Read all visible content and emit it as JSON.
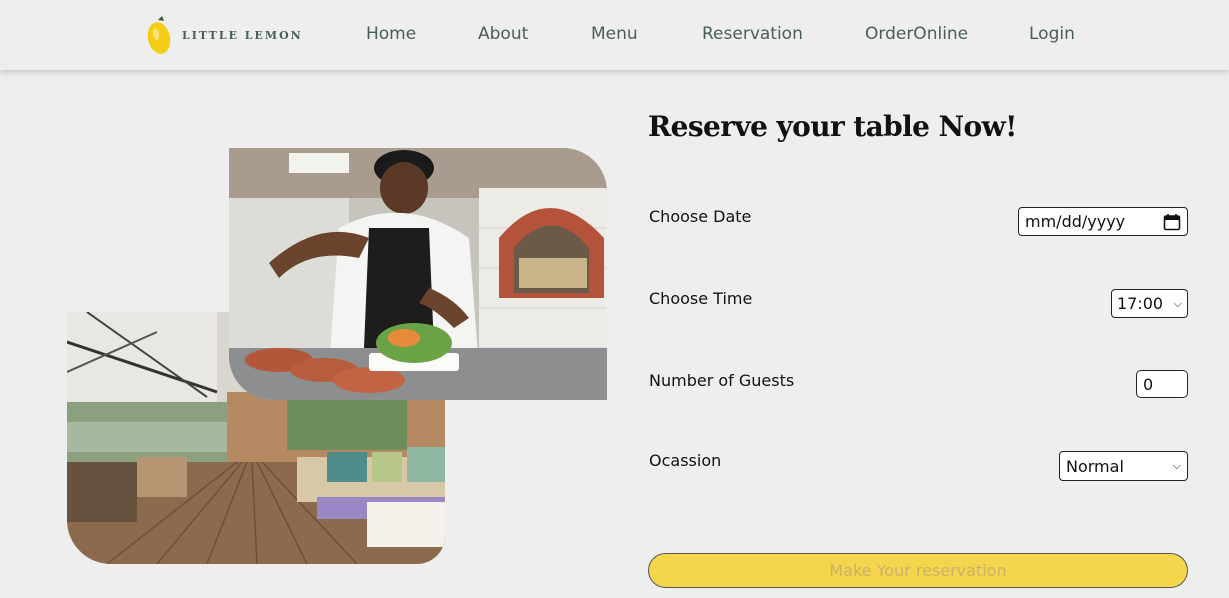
{
  "brand": {
    "name": "LITTLE LEMON",
    "icon": "lemon-logo-icon",
    "accent": "#f4ce14"
  },
  "nav": {
    "home": "Home",
    "about": "About",
    "menu": "Menu",
    "reservation": "Reservation",
    "order_online": "OrderOnline",
    "login": "Login"
  },
  "hero_images": {
    "chef": "chef-plating-photo",
    "terrace": "restaurant-terrace-photo"
  },
  "form": {
    "heading": "Reserve your table Now!",
    "date": {
      "label": "Choose Date",
      "value": "mm/dd/yyyy",
      "icon": "calendar-icon"
    },
    "time": {
      "label": "Choose Time",
      "value": "17:00",
      "icon": "chevron-down-icon"
    },
    "guests": {
      "label": "Number of Guests",
      "value": "0"
    },
    "occasion": {
      "label": "Ocassion",
      "value": "Normal",
      "icon": "chevron-down-icon"
    },
    "submit_label": "Make Your reservation"
  },
  "colors": {
    "background": "#edeeed",
    "nav_text": "#495e57",
    "button": "#f4d54c"
  }
}
